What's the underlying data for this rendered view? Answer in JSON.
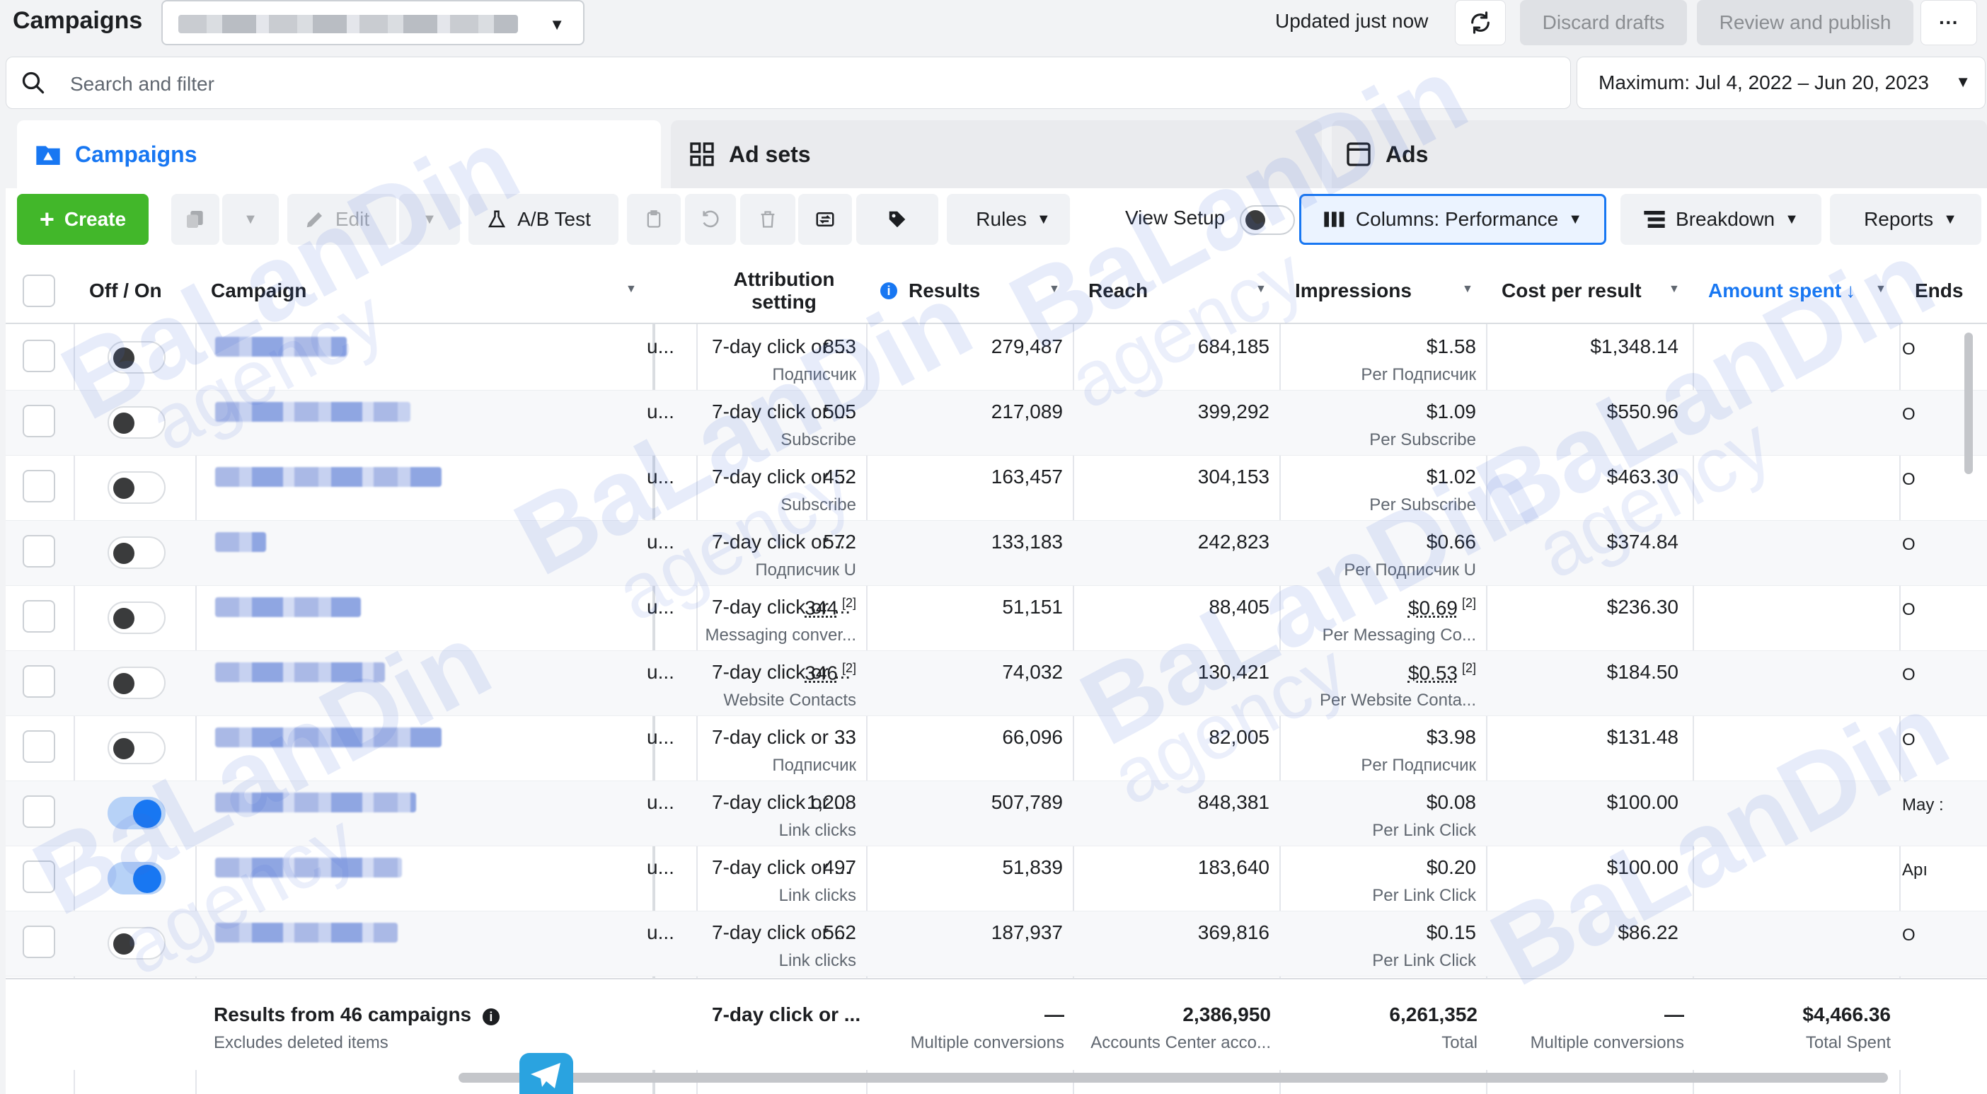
{
  "header": {
    "title": "Campaigns",
    "update_status": "Updated just now",
    "discard_label": "Discard drafts",
    "publish_label": "Review and publish",
    "more_label": "···"
  },
  "search": {
    "placeholder": "Search and filter"
  },
  "date_range": "Maximum: Jul 4, 2022 – Jun 20, 2023",
  "tabs": [
    {
      "label": "Campaigns",
      "active": true
    },
    {
      "label": "Ad sets",
      "active": false
    },
    {
      "label": "Ads",
      "active": false
    }
  ],
  "toolbar": {
    "create_label": "Create",
    "edit_label": "Edit",
    "ab_test_label": "A/B Test",
    "rules_label": "Rules",
    "view_setup_label": "View Setup",
    "columns_label": "Columns: Performance",
    "breakdown_label": "Breakdown",
    "reports_label": "Reports"
  },
  "table": {
    "columns": {
      "off_on": "Off / On",
      "campaign": "Campaign",
      "attribution": "Attribution setting",
      "results": "Results",
      "reach": "Reach",
      "impressions": "Impressions",
      "cost_per_result": "Cost per result",
      "amount_spent": "Amount spent",
      "ends": "Ends"
    },
    "rows": [
      {
        "on": false,
        "delivery": "u...",
        "attribution": "7-day click or ...",
        "results": "853",
        "results_type": "Подписчик",
        "reach": "279,487",
        "impressions": "684,185",
        "cpr": "$1.58",
        "cpr_type": "Per Подписчик",
        "spent": "$1,348.14",
        "ends": "O",
        "blur_w": 186,
        "footnote": false
      },
      {
        "on": false,
        "delivery": "u...",
        "attribution": "7-day click or ...",
        "results": "505",
        "results_type": "Subscribe",
        "reach": "217,089",
        "impressions": "399,292",
        "cpr": "$1.09",
        "cpr_type": "Per Subscribe",
        "spent": "$550.96",
        "ends": "O",
        "blur_w": 276,
        "footnote": false
      },
      {
        "on": false,
        "delivery": "u...",
        "attribution": "7-day click or ...",
        "results": "452",
        "results_type": "Subscribe",
        "reach": "163,457",
        "impressions": "304,153",
        "cpr": "$1.02",
        "cpr_type": "Per Subscribe",
        "spent": "$463.30",
        "ends": "O",
        "blur_w": 320,
        "footnote": false
      },
      {
        "on": false,
        "delivery": "u...",
        "attribution": "7-day click or ...",
        "results": "572",
        "results_type": "Подписчик U",
        "reach": "133,183",
        "impressions": "242,823",
        "cpr": "$0.66",
        "cpr_type": "Per Подписчик U",
        "spent": "$374.84",
        "ends": "O",
        "blur_w": 72,
        "footnote": false
      },
      {
        "on": false,
        "delivery": "u...",
        "attribution": "7-day click or ...",
        "results": "344",
        "results_type": "Messaging conver...",
        "reach": "51,151",
        "impressions": "88,405",
        "cpr": "$0.69",
        "cpr_type": "Per Messaging Co...",
        "spent": "$236.30",
        "ends": "O",
        "blur_w": 206,
        "footnote": true
      },
      {
        "on": false,
        "delivery": "u...",
        "attribution": "7-day click or ...",
        "results": "346",
        "results_type": "Website Contacts",
        "reach": "74,032",
        "impressions": "130,421",
        "cpr": "$0.53",
        "cpr_type": "Per Website Conta...",
        "spent": "$184.50",
        "ends": "O",
        "blur_w": 240,
        "footnote": true
      },
      {
        "on": false,
        "delivery": "u...",
        "attribution": "7-day click or ...",
        "results": "33",
        "results_type": "Подписчик",
        "reach": "66,096",
        "impressions": "82,005",
        "cpr": "$3.98",
        "cpr_type": "Per Подписчик",
        "spent": "$131.48",
        "ends": "O",
        "blur_w": 320,
        "footnote": false
      },
      {
        "on": true,
        "delivery": "u...",
        "attribution": "7-day click or ...",
        "results": "1,208",
        "results_type": "Link clicks",
        "reach": "507,789",
        "impressions": "848,381",
        "cpr": "$0.08",
        "cpr_type": "Per Link Click",
        "spent": "$100.00",
        "ends": "May :",
        "blur_w": 284,
        "footnote": false
      },
      {
        "on": true,
        "delivery": "u...",
        "attribution": "7-day click or ...",
        "results": "497",
        "results_type": "Link clicks",
        "reach": "51,839",
        "impressions": "183,640",
        "cpr": "$0.20",
        "cpr_type": "Per Link Click",
        "spent": "$100.00",
        "ends": "Apı",
        "blur_w": 264,
        "footnote": false
      },
      {
        "on": false,
        "delivery": "u...",
        "attribution": "7-day click or ...",
        "results": "562",
        "results_type": "Link clicks",
        "reach": "187,937",
        "impressions": "369,816",
        "cpr": "$0.15",
        "cpr_type": "Per Link Click",
        "spent": "$86.22",
        "ends": "O",
        "blur_w": 258,
        "footnote": false
      }
    ],
    "summary": {
      "title": "Results from 46 campaigns",
      "subtitle": "Excludes deleted items",
      "attribution": "7-day click or ...",
      "results": "—",
      "results_sub": "Multiple conversions",
      "reach": "2,386,950",
      "reach_sub": "Accounts Center acco...",
      "impressions": "6,261,352",
      "impressions_sub": "Total",
      "cpr": "—",
      "cpr_sub": "Multiple conversions",
      "spent": "$4,466.36",
      "spent_sub": "Total Spent"
    }
  },
  "watermark": {
    "line1": "BaLanDin",
    "line2": "agency"
  },
  "colors": {
    "accent": "#1877f2",
    "create": "#42b72a",
    "watermark": "#466edc"
  }
}
